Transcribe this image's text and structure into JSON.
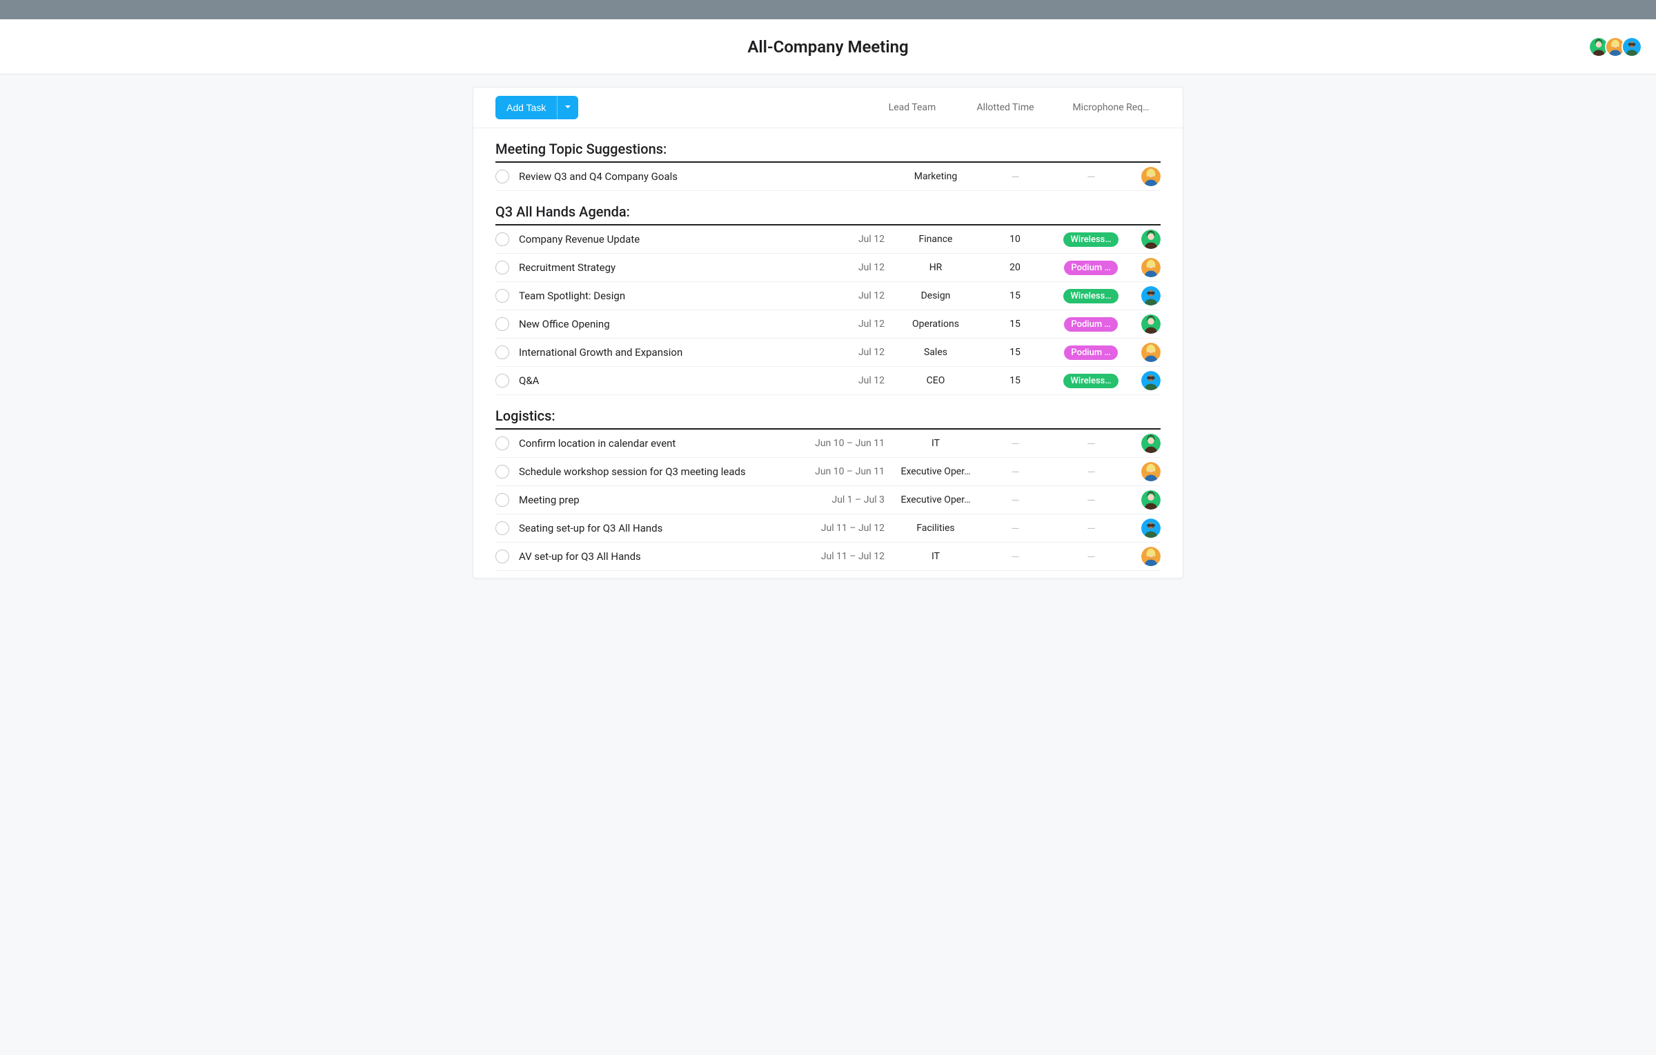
{
  "header": {
    "title": "All-Company Meeting"
  },
  "avatars": {
    "green": {
      "bg": "#25c16f"
    },
    "orange": {
      "bg": "#f2a33a"
    },
    "blue": {
      "bg": "#14aaf5"
    }
  },
  "toolbar": {
    "add_label": "Add Task"
  },
  "columns": {
    "lead": "Lead Team",
    "time": "Allotted Time",
    "mic": "Microphone Req…"
  },
  "sections": [
    {
      "title": "Meeting Topic Suggestions:",
      "rows": [
        {
          "name": "Review Q3 and Q4 Company Goals",
          "date": "",
          "team": "Marketing",
          "time": "—",
          "mic": {
            "label": "—",
            "style": "dash"
          },
          "assignee": "orange"
        }
      ]
    },
    {
      "title": "Q3 All Hands Agenda:",
      "rows": [
        {
          "name": "Company Revenue Update",
          "date": "Jul 12",
          "team": "Finance",
          "time": "10",
          "mic": {
            "label": "Wireless…",
            "style": "green"
          },
          "assignee": "green"
        },
        {
          "name": "Recruitment Strategy",
          "date": "Jul 12",
          "team": "HR",
          "time": "20",
          "mic": {
            "label": "Podium …",
            "style": "magenta"
          },
          "assignee": "orange"
        },
        {
          "name": "Team Spotlight: Design",
          "date": "Jul 12",
          "team": "Design",
          "time": "15",
          "mic": {
            "label": "Wireless…",
            "style": "green"
          },
          "assignee": "blue"
        },
        {
          "name": "New Office Opening",
          "date": "Jul 12",
          "team": "Operations",
          "time": "15",
          "mic": {
            "label": "Podium …",
            "style": "magenta"
          },
          "assignee": "green"
        },
        {
          "name": "International Growth and Expansion",
          "date": "Jul 12",
          "team": "Sales",
          "time": "15",
          "mic": {
            "label": "Podium …",
            "style": "magenta"
          },
          "assignee": "orange"
        },
        {
          "name": "Q&A",
          "date": "Jul 12",
          "team": "CEO",
          "time": "15",
          "mic": {
            "label": "Wireless…",
            "style": "green"
          },
          "assignee": "blue"
        }
      ]
    },
    {
      "title": "Logistics:",
      "rows": [
        {
          "name": "Confirm location in calendar event",
          "date": "Jun 10 – Jun 11",
          "team": "IT",
          "time": "—",
          "mic": {
            "label": "—",
            "style": "dash"
          },
          "assignee": "green"
        },
        {
          "name": "Schedule workshop session for Q3 meeting leads",
          "date": "Jun 10 – Jun 11",
          "team": "Executive Oper…",
          "time": "—",
          "mic": {
            "label": "—",
            "style": "dash"
          },
          "assignee": "orange"
        },
        {
          "name": "Meeting prep",
          "date": "Jul 1 – Jul 3",
          "team": "Executive Oper…",
          "time": "—",
          "mic": {
            "label": "—",
            "style": "dash"
          },
          "assignee": "green"
        },
        {
          "name": "Seating set-up for Q3 All Hands",
          "date": "Jul 11 – Jul 12",
          "team": "Facilities",
          "time": "—",
          "mic": {
            "label": "—",
            "style": "dash"
          },
          "assignee": "blue"
        },
        {
          "name": "AV set-up for Q3 All Hands",
          "date": "Jul 11 – Jul 12",
          "team": "IT",
          "time": "—",
          "mic": {
            "label": "—",
            "style": "dash"
          },
          "assignee": "orange"
        }
      ]
    }
  ]
}
